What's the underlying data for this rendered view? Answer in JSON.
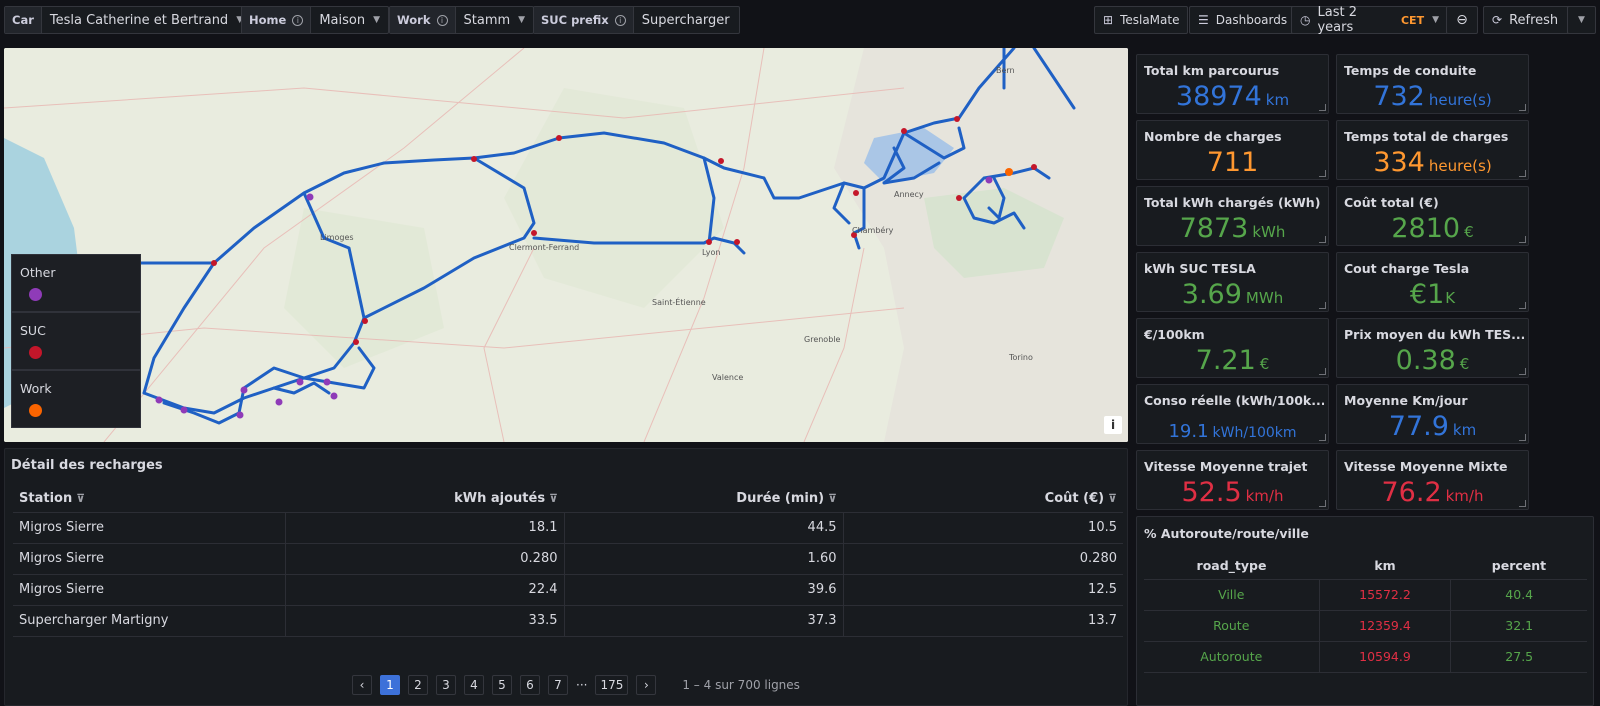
{
  "toolbar": {
    "vars": [
      {
        "label": "Car",
        "value": "Tesla Catherine et Bertrand",
        "info": false
      },
      {
        "label": "Home",
        "value": "Maison",
        "info": true
      },
      {
        "label": "Work",
        "value": "Stamm",
        "info": true
      },
      {
        "label": "SUC prefix",
        "value": "Supercharger",
        "info": true
      }
    ],
    "teslamate": "TeslaMate",
    "dashboards": "Dashboards",
    "timerange": "Last 2 years",
    "timezone": "CET",
    "refresh": "Refresh"
  },
  "map": {
    "legend": [
      {
        "label": "Other",
        "color": "#8f3bb8"
      },
      {
        "label": "SUC",
        "color": "#c4162a"
      },
      {
        "label": "Work",
        "color": "#fa6400"
      }
    ],
    "info_icon": "i",
    "route_color": "#1f60c4",
    "places": [
      "Lyon",
      "Limoges",
      "Clermont-Ferrand",
      "Saint-Étienne",
      "Grenoble",
      "Valence",
      "Torino",
      "Bern",
      "Annecy",
      "Chambéry"
    ]
  },
  "recharges": {
    "title": "Détail des recharges",
    "columns": [
      "Station",
      "kWh ajoutés",
      "Durée (min)",
      "Coût (€)"
    ],
    "rows": [
      [
        "Migros Sierre",
        "18.1",
        "44.5",
        "10.5"
      ],
      [
        "Migros Sierre",
        "0.280",
        "1.60",
        "0.280"
      ],
      [
        "Migros Sierre",
        "22.4",
        "39.6",
        "12.5"
      ],
      [
        "Supercharger Martigny",
        "33.5",
        "37.3",
        "13.7"
      ]
    ],
    "pages": [
      "1",
      "2",
      "3",
      "4",
      "5",
      "6",
      "7",
      "175"
    ],
    "ellipsis": "···",
    "summary": "1 – 4 sur 700 lignes"
  },
  "stats": [
    {
      "title": "Total km parcourus",
      "value": "38974",
      "unit": "km",
      "color": "blue"
    },
    {
      "title": "Temps de conduite",
      "value": "732",
      "unit": "heure(s)",
      "color": "blue"
    },
    {
      "title": "Nombre de charges",
      "value": "711",
      "unit": "",
      "color": "orange"
    },
    {
      "title": "Temps total de charges",
      "value": "334",
      "unit": "heure(s)",
      "color": "orange"
    },
    {
      "title": "Total kWh chargés (kWh)",
      "value": "7873",
      "unit": "kWh",
      "color": "green"
    },
    {
      "title": "Coût total (€)",
      "value": "2810",
      "unit": "€",
      "color": "green"
    },
    {
      "title": "kWh SUC TESLA",
      "value": "3.69",
      "unit": "MWh",
      "color": "green"
    },
    {
      "title": "Cout charge Tesla",
      "value": "€1",
      "unit": "K",
      "color": "green"
    },
    {
      "title": "€/100km",
      "value": "7.21",
      "unit": "€",
      "color": "green"
    },
    {
      "title": "Prix moyen du kWh TES...",
      "value": "0.38",
      "unit": "€",
      "color": "green"
    },
    {
      "title": "Conso réelle (kWh/100k...",
      "value": "19.1",
      "unit": "kWh/100km",
      "color": "blue",
      "small": true
    },
    {
      "title": "Moyenne Km/jour",
      "value": "77.9",
      "unit": "km",
      "color": "blue"
    },
    {
      "title": "Vitesse Moyenne trajet",
      "value": "52.5",
      "unit": "km/h",
      "color": "red"
    },
    {
      "title": "Vitesse Moyenne Mixte",
      "value": "76.2",
      "unit": "km/h",
      "color": "red"
    }
  ],
  "roadtype": {
    "title": "% Autoroute/route/ville",
    "columns": [
      "road_type",
      "km",
      "percent"
    ],
    "rows": [
      [
        "Ville",
        "15572.2",
        "40.4"
      ],
      [
        "Route",
        "12359.4",
        "32.1"
      ],
      [
        "Autoroute",
        "10594.9",
        "27.5"
      ]
    ]
  }
}
